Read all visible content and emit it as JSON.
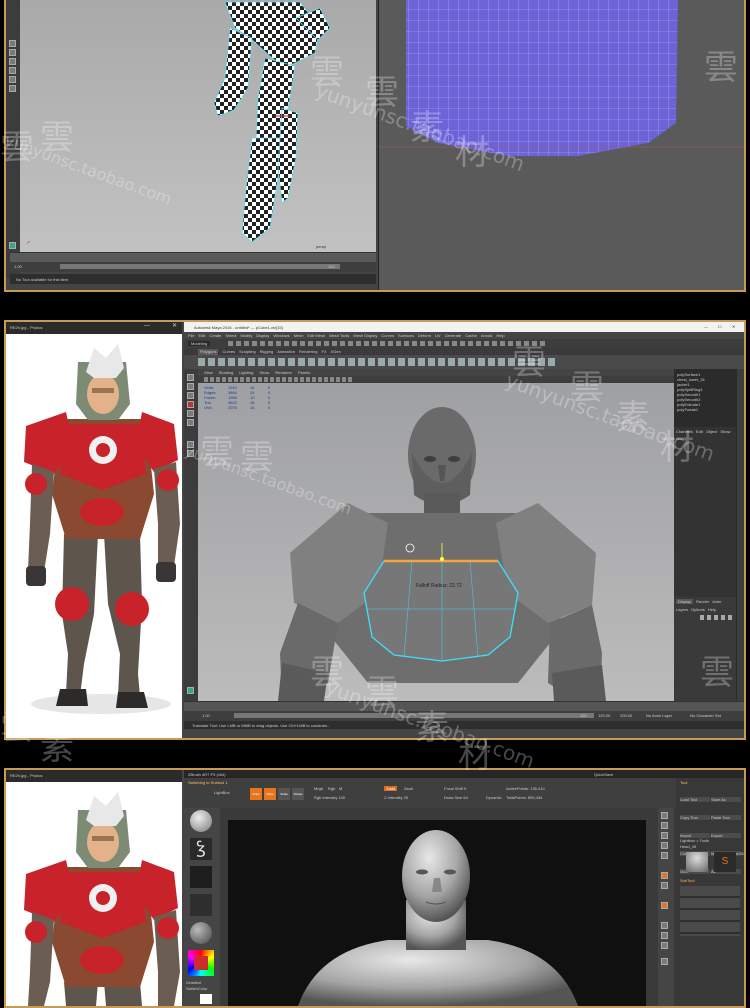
{
  "panel1": {
    "status_text": "No Tool available for this item",
    "timeline_start": "1.00",
    "timeline_end": "120",
    "viewport_label": "persp"
  },
  "panel2": {
    "photo_title": "RE2h.jpg - Photos",
    "app_title": "Autodesk Maya 2016 - untitled* --- pCube1.vtx[15]",
    "menus": [
      "File",
      "Edit",
      "Create",
      "Select",
      "Modify",
      "Display",
      "Windows",
      "Mesh",
      "Edit Mesh",
      "Mesh Tools",
      "Mesh Display",
      "Curves",
      "Surfaces",
      "Deform",
      "UV",
      "Generate",
      "Cache",
      "Arnold",
      "Help"
    ],
    "mode_select": "Modeling",
    "shelf_tabs": [
      "Polygons",
      "Curves",
      "Sculpting",
      "Rigging",
      "Animation",
      "Rendering",
      "FX",
      "XGen"
    ],
    "panel_menus": [
      "View",
      "Shading",
      "Lighting",
      "Show",
      "Renderer",
      "Panels"
    ],
    "hud_stats": [
      {
        "label": "Verts:",
        "a": "1910",
        "b": "16",
        "c": "0"
      },
      {
        "label": "Edges:",
        "a": "3864",
        "b": "24",
        "c": "0"
      },
      {
        "label": "Faces:",
        "a": "1956",
        "b": "10",
        "c": "0"
      },
      {
        "label": "Tris:",
        "a": "3822",
        "b": "16",
        "c": "0"
      },
      {
        "label": "UVs:",
        "a": "2076",
        "b": "16",
        "c": "0"
      }
    ],
    "falloff_label": "Falloff Radius: 22.72",
    "outliner_items": [
      "polySurface1",
      "chest_lower_01",
      "jacket1",
      "polySplitRing1",
      "polySmooth1",
      "polySmooth2",
      "polyExtrude1",
      "polyTweak1"
    ],
    "channel_tabs": [
      "Channels",
      "Edit",
      "Object",
      "Show"
    ],
    "layer_tabs": [
      "Display",
      "Render",
      "Anim"
    ],
    "layer_menus": [
      "Layers",
      "Options",
      "Help"
    ],
    "timeline_start": "1.00",
    "timeline_end": "120",
    "range_end": "120.00",
    "range_max": "200.00",
    "anim_layer": "No Anim Layer",
    "char_set": "No Character Set",
    "status_text": "Translate Tool: Use LMB or MMB to drag objects. Use Ctrl+LMB to constrain..."
  },
  "panel3": {
    "photo_title": "RE2h.jpg - Photos",
    "app_title": "ZBrush 4R7 P3 (x64)",
    "toolbar_text": "Switching to Subtool 1",
    "tool_label": "Tool",
    "lightbox_label": "LightBox",
    "quick_save_label": "QuickSave",
    "brush_label": "Standard",
    "draw_buttons": [
      "Draw",
      "Move",
      "Scale",
      "Rotate"
    ],
    "mrgb_label": "Mrgb",
    "rgb_label": "Rgb",
    "m_label": "M",
    "zadd_label": "Zadd",
    "zsub_label": "Zsub",
    "rgb_intensity": "Rgb Intensity 100",
    "z_intensity": "Z Intensity 25",
    "focal_shift": "Focal Shift 0",
    "draw_size": "Draw Size 64",
    "active_points": "ActivePoints: 135,410",
    "total_points": "TotalPoints: 899,434",
    "dynamic_label": "Dynamic",
    "gradient_label": "Gradient",
    "switch_color_label": "SwitchColor",
    "tool_menu": [
      "Load Tool",
      "Save As",
      "Copy Tool",
      "Paste Tool",
      "Import",
      "Export",
      "Clone",
      "Make PolyMesh3D",
      "GoZ",
      "All",
      "Visible"
    ],
    "lightbox_tools": "Lightbox > Tools",
    "tool_name": "Head_49",
    "subtool_label": "SubTool"
  },
  "watermarks": {
    "chars": [
      "雲",
      "雲",
      "素",
      "材"
    ],
    "url": "yunyunsc.taobao.com"
  },
  "colors": {
    "frame": "#c89a55",
    "maya_bg": "#444444",
    "viewport_grey": "#b8b8b8",
    "uv_blue": "#6b63d6",
    "armor_red": "#c8222a",
    "selection_cyan": "#3ce0ff",
    "zbrush_orange": "#e8741c"
  }
}
